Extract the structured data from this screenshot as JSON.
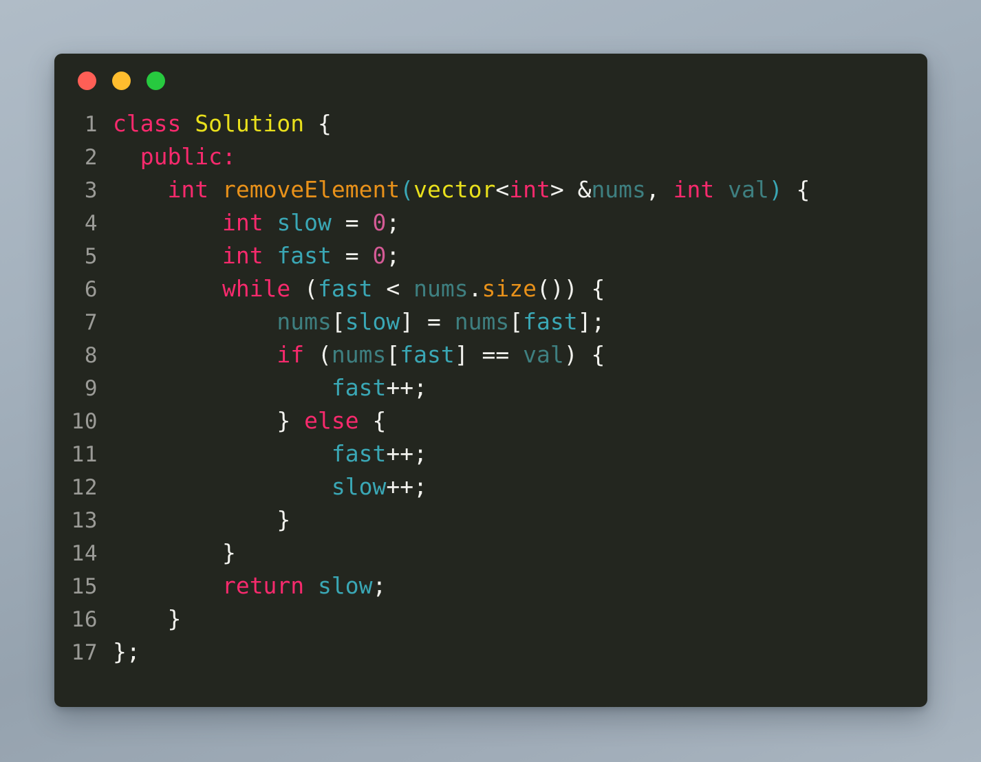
{
  "window": {
    "background_gradient_from": "#b0bcc7",
    "background_gradient_to": "#a9b5c0",
    "card_background": "#23261f",
    "traffic_lights": [
      {
        "name": "close",
        "color": "#ff5f56"
      },
      {
        "name": "minimize",
        "color": "#ffbd2e"
      },
      {
        "name": "maximize",
        "color": "#27c93f"
      }
    ]
  },
  "editor": {
    "language": "cpp",
    "theme_colors": {
      "plain": "#f2f2ee",
      "keyword": "#f72a6d",
      "type": "#e9e01c",
      "function": "#e8911a",
      "variable": "#3aa7b5",
      "parameter": "#3e7f80",
      "number": "#d45a95",
      "paren": "#3aa7b5",
      "line_number": "#9b9b97"
    },
    "line_numbers": [
      "1",
      "2",
      "3",
      "4",
      "5",
      "6",
      "7",
      "8",
      "9",
      "10",
      "11",
      "12",
      "13",
      "14",
      "15",
      "16",
      "17"
    ],
    "plain_text": "class Solution {\n  public:\n    int removeElement(vector<int> &nums, int val) {\n        int slow = 0;\n        int fast = 0;\n        while (fast < nums.size()) {\n            nums[slow] = nums[fast];\n            if (nums[fast] == val) {\n                fast++;\n            } else {\n                fast++;\n                slow++;\n            }\n        }\n        return slow;\n    }\n};",
    "lines": [
      {
        "number": "1",
        "tokens": [
          {
            "text": "class",
            "cls": "t-key"
          },
          {
            "text": " ",
            "cls": "t-plain"
          },
          {
            "text": "Solution",
            "cls": "t-type"
          },
          {
            "text": " {",
            "cls": "t-plain"
          }
        ]
      },
      {
        "number": "2",
        "tokens": [
          {
            "text": "  ",
            "cls": "t-plain"
          },
          {
            "text": "public:",
            "cls": "t-key"
          }
        ]
      },
      {
        "number": "3",
        "tokens": [
          {
            "text": "    ",
            "cls": "t-plain"
          },
          {
            "text": "int",
            "cls": "t-key"
          },
          {
            "text": " ",
            "cls": "t-plain"
          },
          {
            "text": "removeElement",
            "cls": "t-fn"
          },
          {
            "text": "(",
            "cls": "t-paren"
          },
          {
            "text": "vector",
            "cls": "t-type"
          },
          {
            "text": "<",
            "cls": "t-plain"
          },
          {
            "text": "int",
            "cls": "t-key"
          },
          {
            "text": "> &",
            "cls": "t-plain"
          },
          {
            "text": "nums",
            "cls": "t-param"
          },
          {
            "text": ", ",
            "cls": "t-plain"
          },
          {
            "text": "int",
            "cls": "t-key"
          },
          {
            "text": " ",
            "cls": "t-plain"
          },
          {
            "text": "val",
            "cls": "t-param"
          },
          {
            "text": ")",
            "cls": "t-paren"
          },
          {
            "text": " {",
            "cls": "t-plain"
          }
        ]
      },
      {
        "number": "4",
        "tokens": [
          {
            "text": "        ",
            "cls": "t-plain"
          },
          {
            "text": "int",
            "cls": "t-key"
          },
          {
            "text": " ",
            "cls": "t-plain"
          },
          {
            "text": "slow",
            "cls": "t-var"
          },
          {
            "text": " = ",
            "cls": "t-plain"
          },
          {
            "text": "0",
            "cls": "t-num"
          },
          {
            "text": ";",
            "cls": "t-plain"
          }
        ]
      },
      {
        "number": "5",
        "tokens": [
          {
            "text": "        ",
            "cls": "t-plain"
          },
          {
            "text": "int",
            "cls": "t-key"
          },
          {
            "text": " ",
            "cls": "t-plain"
          },
          {
            "text": "fast",
            "cls": "t-var"
          },
          {
            "text": " = ",
            "cls": "t-plain"
          },
          {
            "text": "0",
            "cls": "t-num"
          },
          {
            "text": ";",
            "cls": "t-plain"
          }
        ]
      },
      {
        "number": "6",
        "tokens": [
          {
            "text": "        ",
            "cls": "t-plain"
          },
          {
            "text": "while",
            "cls": "t-key"
          },
          {
            "text": " (",
            "cls": "t-plain"
          },
          {
            "text": "fast",
            "cls": "t-var"
          },
          {
            "text": " < ",
            "cls": "t-plain"
          },
          {
            "text": "nums",
            "cls": "t-param"
          },
          {
            "text": ".",
            "cls": "t-plain"
          },
          {
            "text": "size",
            "cls": "t-fn"
          },
          {
            "text": "()) {",
            "cls": "t-plain"
          }
        ]
      },
      {
        "number": "7",
        "tokens": [
          {
            "text": "            ",
            "cls": "t-plain"
          },
          {
            "text": "nums",
            "cls": "t-param"
          },
          {
            "text": "[",
            "cls": "t-plain"
          },
          {
            "text": "slow",
            "cls": "t-var"
          },
          {
            "text": "] = ",
            "cls": "t-plain"
          },
          {
            "text": "nums",
            "cls": "t-param"
          },
          {
            "text": "[",
            "cls": "t-plain"
          },
          {
            "text": "fast",
            "cls": "t-var"
          },
          {
            "text": "];",
            "cls": "t-plain"
          }
        ]
      },
      {
        "number": "8",
        "tokens": [
          {
            "text": "            ",
            "cls": "t-plain"
          },
          {
            "text": "if",
            "cls": "t-key"
          },
          {
            "text": " (",
            "cls": "t-plain"
          },
          {
            "text": "nums",
            "cls": "t-param"
          },
          {
            "text": "[",
            "cls": "t-plain"
          },
          {
            "text": "fast",
            "cls": "t-var"
          },
          {
            "text": "] == ",
            "cls": "t-plain"
          },
          {
            "text": "val",
            "cls": "t-param"
          },
          {
            "text": ") {",
            "cls": "t-plain"
          }
        ]
      },
      {
        "number": "9",
        "tokens": [
          {
            "text": "                ",
            "cls": "t-plain"
          },
          {
            "text": "fast",
            "cls": "t-var"
          },
          {
            "text": "++;",
            "cls": "t-plain"
          }
        ]
      },
      {
        "number": "10",
        "tokens": [
          {
            "text": "            } ",
            "cls": "t-plain"
          },
          {
            "text": "else",
            "cls": "t-key"
          },
          {
            "text": " {",
            "cls": "t-plain"
          }
        ]
      },
      {
        "number": "11",
        "tokens": [
          {
            "text": "                ",
            "cls": "t-plain"
          },
          {
            "text": "fast",
            "cls": "t-var"
          },
          {
            "text": "++;",
            "cls": "t-plain"
          }
        ]
      },
      {
        "number": "12",
        "tokens": [
          {
            "text": "                ",
            "cls": "t-plain"
          },
          {
            "text": "slow",
            "cls": "t-var"
          },
          {
            "text": "++;",
            "cls": "t-plain"
          }
        ]
      },
      {
        "number": "13",
        "tokens": [
          {
            "text": "            }",
            "cls": "t-plain"
          }
        ]
      },
      {
        "number": "14",
        "tokens": [
          {
            "text": "        }",
            "cls": "t-plain"
          }
        ]
      },
      {
        "number": "15",
        "tokens": [
          {
            "text": "        ",
            "cls": "t-plain"
          },
          {
            "text": "return",
            "cls": "t-key"
          },
          {
            "text": " ",
            "cls": "t-plain"
          },
          {
            "text": "slow",
            "cls": "t-var"
          },
          {
            "text": ";",
            "cls": "t-plain"
          }
        ]
      },
      {
        "number": "16",
        "tokens": [
          {
            "text": "    }",
            "cls": "t-plain"
          }
        ]
      },
      {
        "number": "17",
        "tokens": [
          {
            "text": "};",
            "cls": "t-plain"
          }
        ]
      }
    ]
  }
}
